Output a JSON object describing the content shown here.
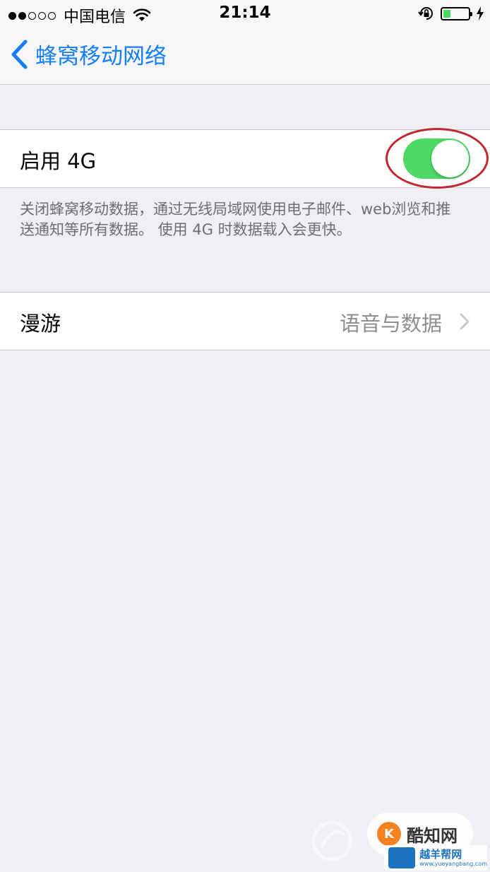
{
  "status_bar": {
    "signal_bars_filled": 2,
    "signal_bars_total": 5,
    "carrier": "中国电信",
    "time": "21:14",
    "battery_level": 0.3,
    "icons": [
      "wifi-icon",
      "rotation-lock-icon",
      "battery-icon",
      "charging-bolt-icon"
    ]
  },
  "nav": {
    "back_label": "蜂窝移动网络"
  },
  "enable_4g": {
    "label": "启用 4G",
    "toggle_on": true,
    "footer": "关闭蜂窝移动数据，通过无线局域网使用电子邮件、web浏览和推送通知等所有数据。 使用 4G 时数据载入会更快。"
  },
  "roaming": {
    "label": "漫游",
    "value": "语音与数据"
  },
  "colors": {
    "accent": "#157efb",
    "toggle_on": "#4cd964",
    "highlight": "#c1272d",
    "background": "#efeff4"
  },
  "watermarks": {
    "kuzhiwang": "酷知网",
    "site_name": "越羊帮网",
    "site_url": "www.yueyangbang.com"
  }
}
